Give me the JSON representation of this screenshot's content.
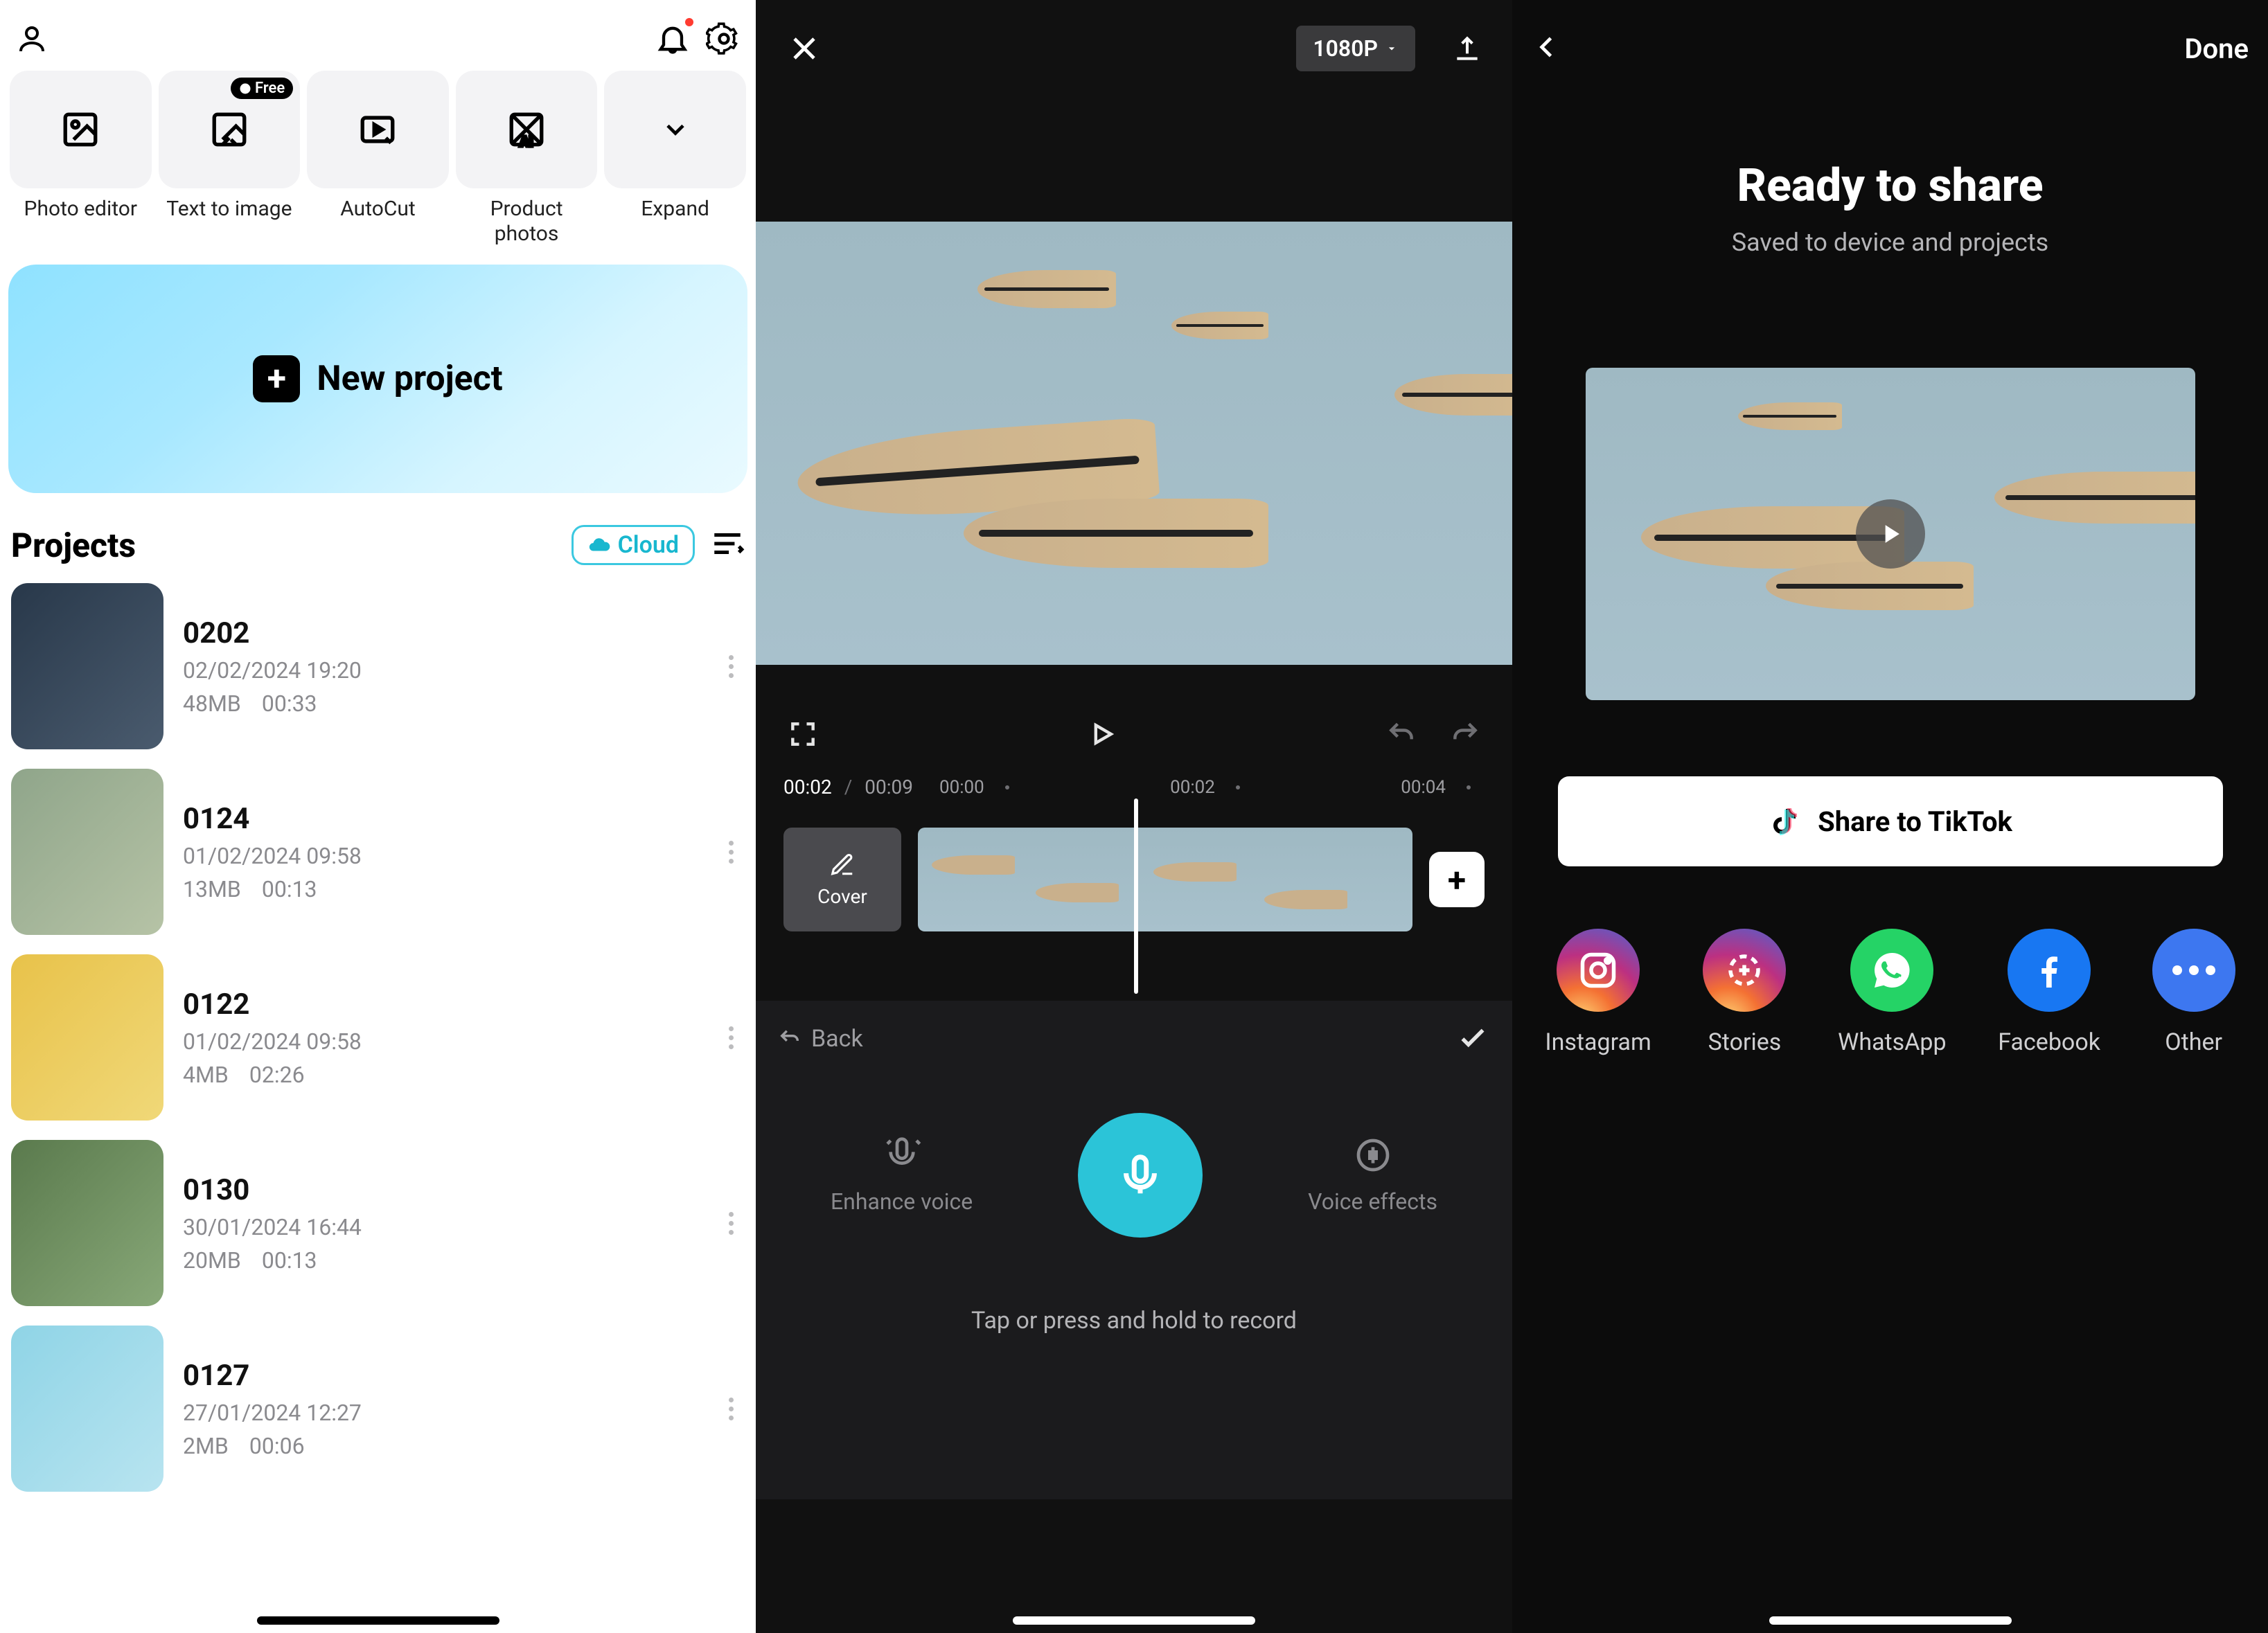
{
  "panel1": {
    "tools": [
      {
        "label": "Photo editor",
        "badge": null
      },
      {
        "label": "Text to image",
        "badge": "Free"
      },
      {
        "label": "AutoCut",
        "badge": null
      },
      {
        "label": "Product photos",
        "badge": null
      },
      {
        "label": "Expand",
        "badge": null
      }
    ],
    "new_project_label": "New project",
    "projects_title": "Projects",
    "cloud_label": "Cloud",
    "projects": [
      {
        "name": "0202",
        "date": "02/02/2024 19:20",
        "size": "48MB",
        "dur": "00:33"
      },
      {
        "name": "0124",
        "date": "01/02/2024 09:58",
        "size": "13MB",
        "dur": "00:13"
      },
      {
        "name": "0122",
        "date": "01/02/2024 09:58",
        "size": "4MB",
        "dur": "02:26"
      },
      {
        "name": "0130",
        "date": "30/01/2024 16:44",
        "size": "20MB",
        "dur": "00:13"
      },
      {
        "name": "0127",
        "date": "27/01/2024 12:27",
        "size": "2MB",
        "dur": "00:06"
      }
    ]
  },
  "panel2": {
    "resolution": "1080P",
    "time_current": "00:02",
    "time_total": "00:09",
    "ticks": [
      "00:00",
      "00:02",
      "00:04"
    ],
    "cover_label": "Cover",
    "back_label": "Back",
    "enhance_label": "Enhance voice",
    "effects_label": "Voice effects",
    "record_hint": "Tap or press and hold to record"
  },
  "panel3": {
    "title": "Ready to share",
    "subtitle": "Saved to device and projects",
    "done_label": "Done",
    "tiktok_label": "Share to TikTok",
    "share_targets": [
      {
        "name": "Instagram"
      },
      {
        "name": "Stories"
      },
      {
        "name": "WhatsApp"
      },
      {
        "name": "Facebook"
      },
      {
        "name": "Other"
      }
    ]
  }
}
